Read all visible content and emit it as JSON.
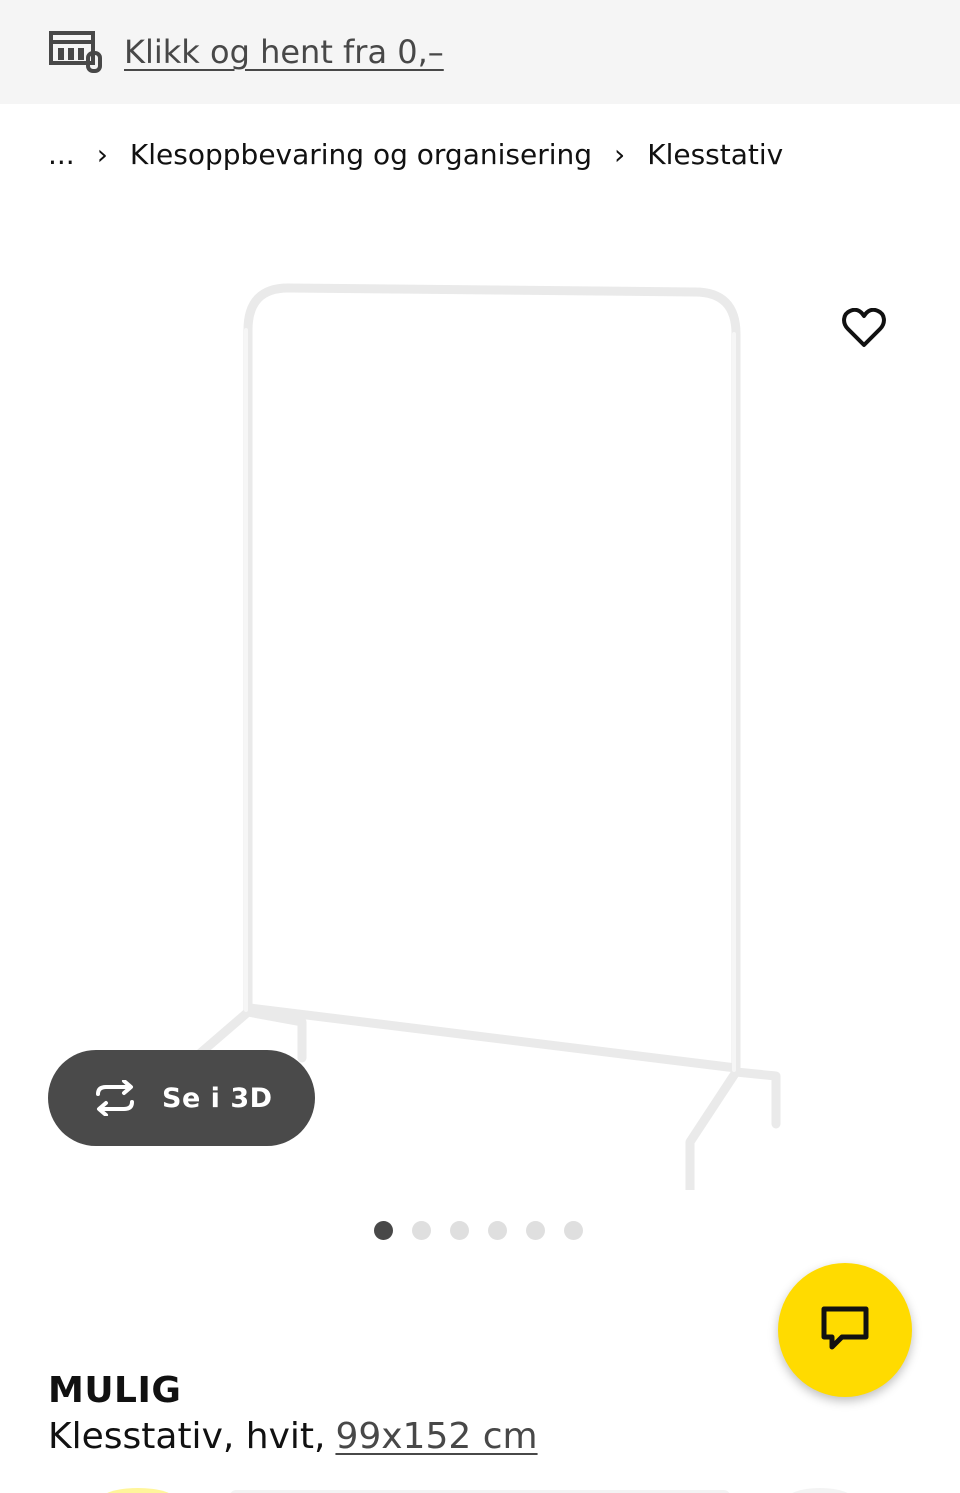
{
  "promo": {
    "icon": "store-pickup-icon",
    "text": "Klikk og hent fra 0,–"
  },
  "breadcrumb": {
    "ellipsis": "...",
    "separator": "›",
    "items": [
      "Klesoppbevaring og organisering",
      "Klesstativ"
    ]
  },
  "gallery": {
    "favorite_icon": "heart-icon",
    "view_3d_icon": "rotate-icon",
    "view_3d_label": "Se i 3D",
    "dots_total": 6,
    "active_dot": 1
  },
  "chat": {
    "icon": "chat-icon",
    "color": "#ffdb00"
  },
  "product": {
    "name": "MULIG",
    "description": "Klesstativ, hvit,",
    "size": "99x152 cm"
  },
  "colors": {
    "promo_bg": "#f5f5f5",
    "button_dark": "#4a4a4a",
    "accent_yellow": "#ffdb00"
  }
}
